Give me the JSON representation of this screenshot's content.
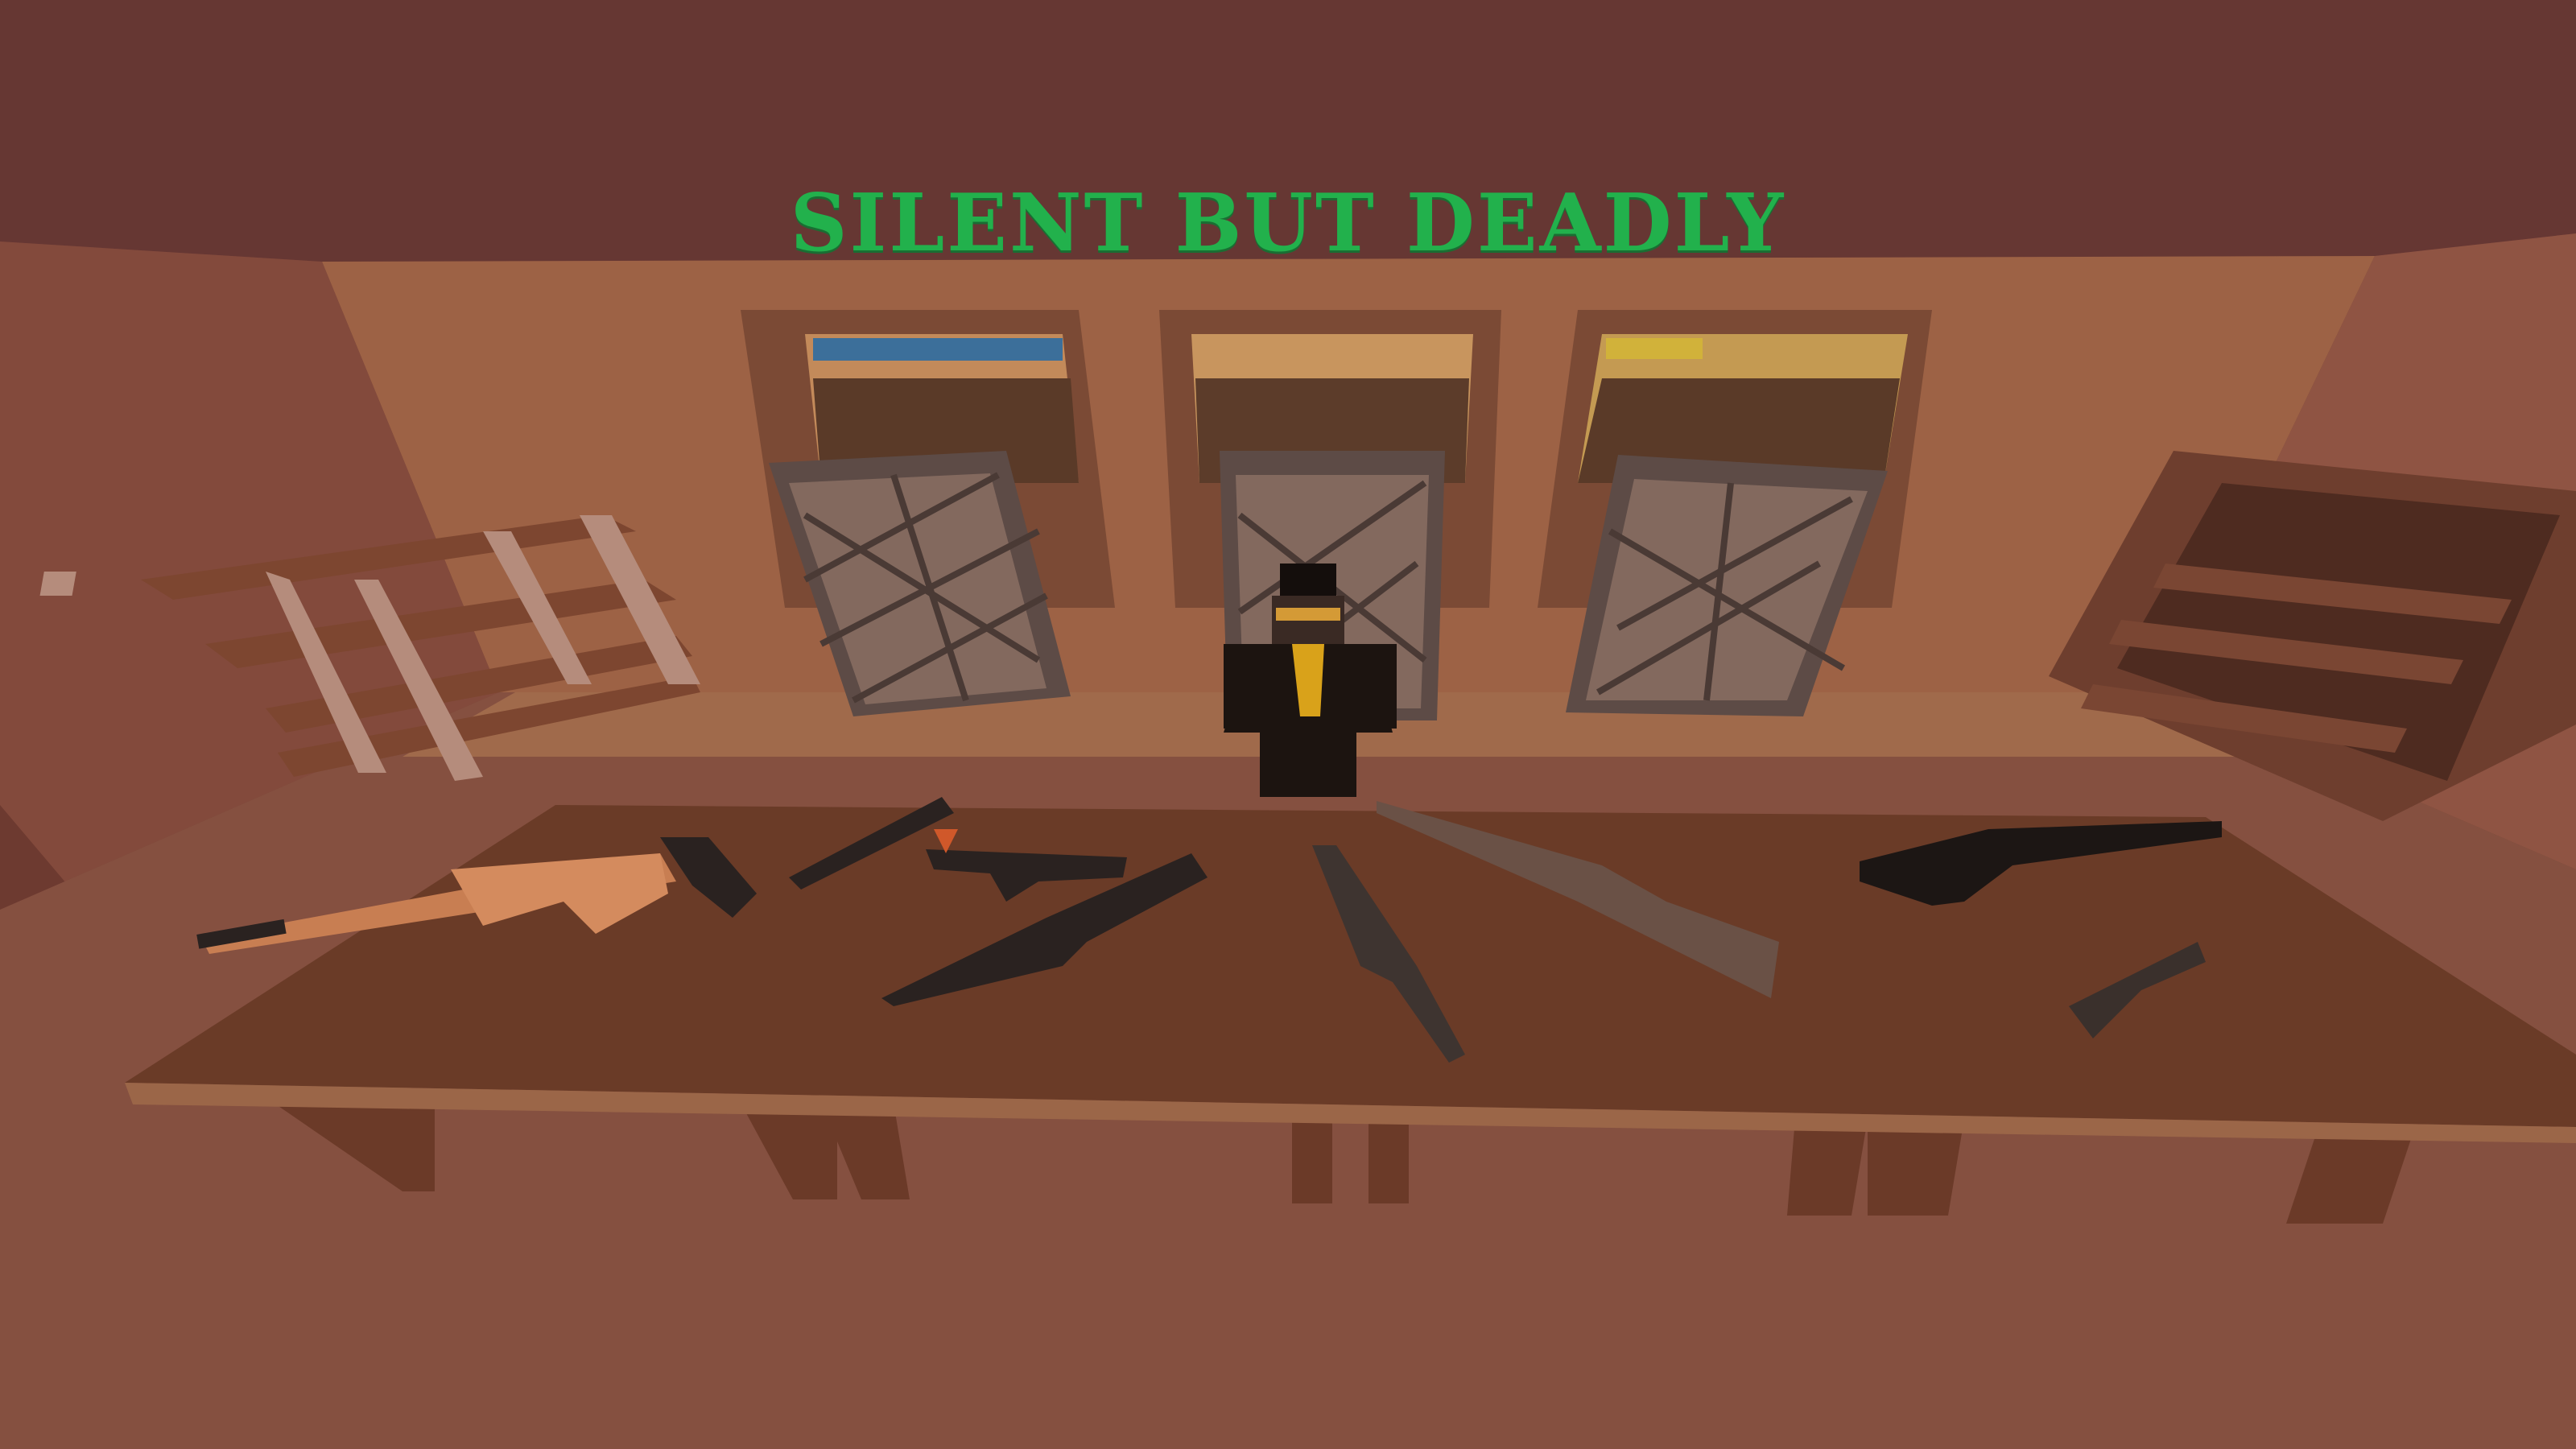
{
  "title": {
    "text": "SILENT BUT DEADLY",
    "color": "#22b14c"
  },
  "palette": {
    "ceiling": "#663733",
    "back_wall": "#9d6245",
    "left_wall": "#834a3c",
    "right_wall": "#8f5443",
    "floor": "#855040",
    "table_top": "#6a3b27",
    "table_front": "#9b6648",
    "shelf_wood": "#7d4630",
    "locker_metal": "#6b5b55",
    "character_suit": "#1c1410",
    "character_tie": "#d9a21a",
    "gun_dark": "#2a2220",
    "gun_wood": "#c87e52"
  }
}
